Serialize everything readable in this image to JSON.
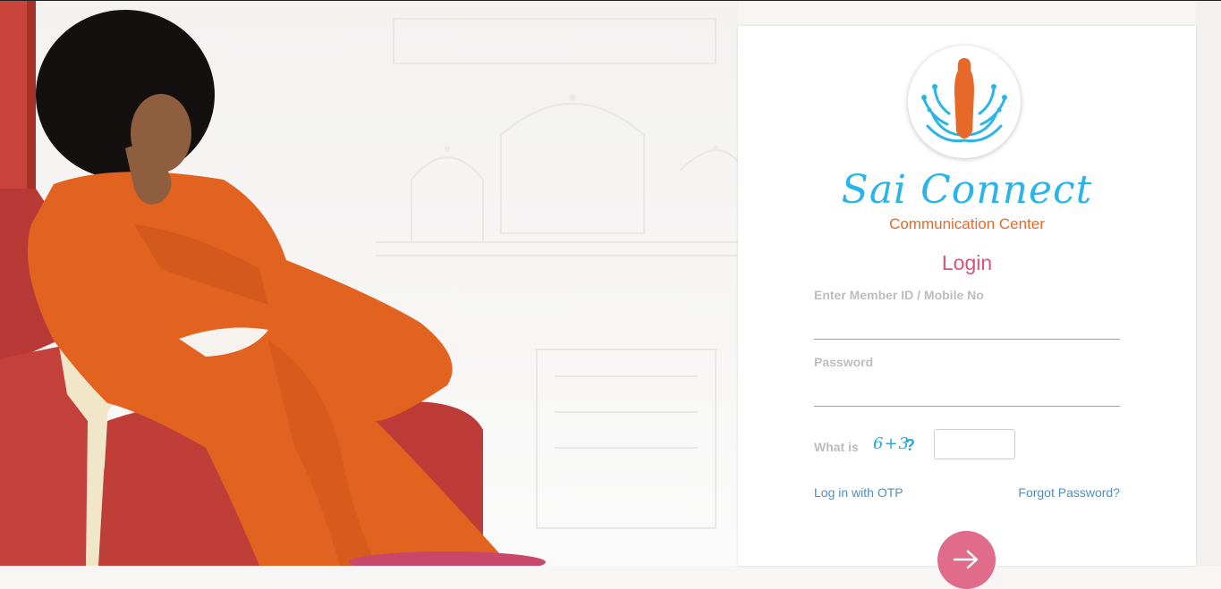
{
  "brand": {
    "title": "Sai Connect",
    "subtitle": "Communication Center"
  },
  "login": {
    "heading": "Login",
    "member_label": "Enter Member ID / Mobile No",
    "member_value": "",
    "password_label": "Password",
    "password_value": "",
    "captcha_label": "What is",
    "captcha_text": "6+3",
    "captcha_question_mark": "?",
    "captcha_value": "",
    "otp_link": "Log in with OTP",
    "forgot_link": "Forgot Password?"
  },
  "icons": {
    "logo": "lotus-figure-logo-icon",
    "submit": "arrow-right-icon"
  },
  "colors": {
    "brand_blue": "#29b5e8",
    "brand_orange": "#e7692a",
    "heading_pink": "#d8547c",
    "button_pink": "#e06b8a",
    "link_blue": "#4a90c9"
  }
}
